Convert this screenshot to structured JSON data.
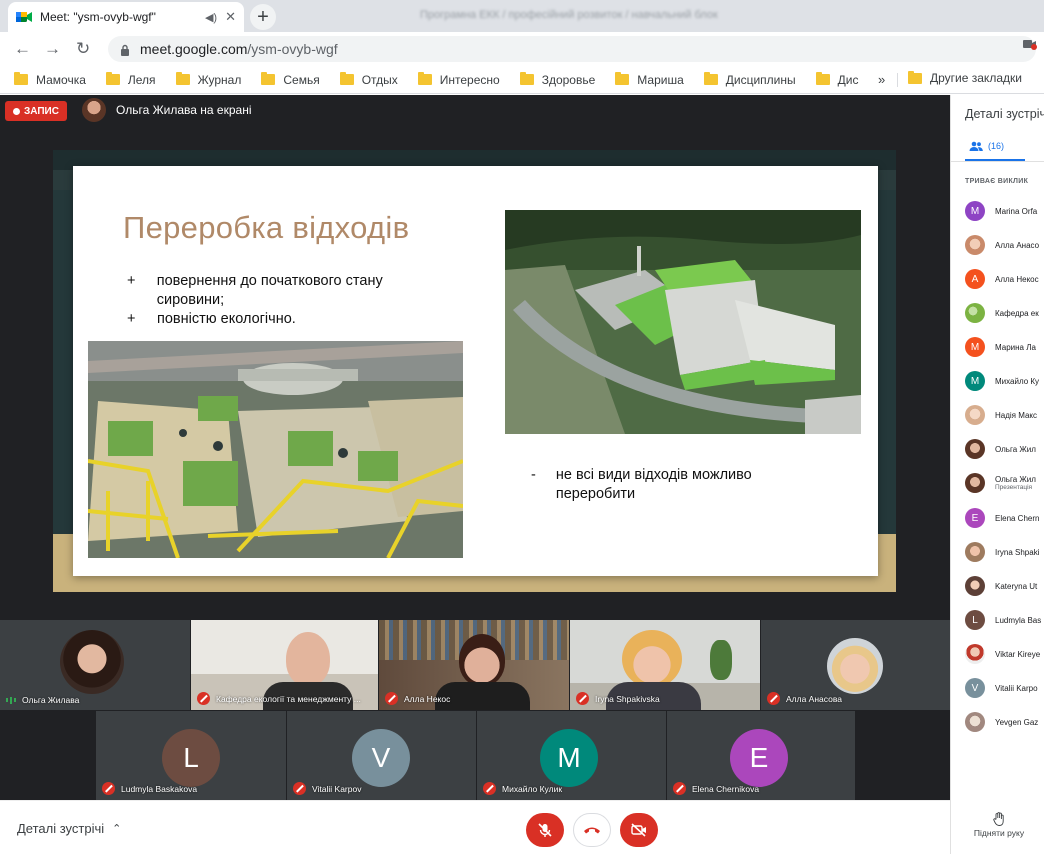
{
  "browser": {
    "tab_title": "Meet: \"ysm-ovyb-wgf\"",
    "ghost_tab_title": "Програмна ЕКК / професійний розвиток / навчальний блок",
    "url_host": "meet.google.com",
    "url_path": "/ysm-ovyb-wgf",
    "bookmarks": [
      "Мамочка",
      "Леля",
      "Журнал",
      "Семья",
      "Отдых",
      "Интересно",
      "Здоровье",
      "Мариша",
      "Дисциплины",
      "Дис"
    ],
    "bookmarks_more": "»",
    "other_bookmarks": "Другие закладки"
  },
  "meet": {
    "recording_label": "ЗАПИС",
    "presenter_text": "Ольга Жилава на екрані",
    "slide": {
      "title": "Переробка відходів",
      "bullet_marker_plus": "+",
      "bullet_marker_minus": "-",
      "pros": [
        "повернення до початкового стану сировини;",
        "повністю екологічно."
      ],
      "cons": [
        "не всі види відходів можливо переробити"
      ]
    },
    "tiles_row1": [
      {
        "name": "Ольга Жилава",
        "muted": false
      },
      {
        "name": "Кафедра екології та менеджменту ...",
        "muted": true
      },
      {
        "name": "Алла Некос",
        "muted": true
      },
      {
        "name": "Iryna Shpakivska",
        "muted": true
      },
      {
        "name": "Алла Анасова",
        "muted": true
      }
    ],
    "tiles_row2": [
      {
        "letter": "L",
        "name": "Ludmyla Baskakova",
        "color": "#6d4c41"
      },
      {
        "letter": "V",
        "name": "Vitalii Karpov",
        "color": "#78909c"
      },
      {
        "letter": "M",
        "name": "Михайло Кулик",
        "color": "#00897b"
      },
      {
        "letter": "E",
        "name": "Elena Chernikova",
        "color": "#ab47bc"
      }
    ],
    "meeting_details_label": "Деталі зустрічі"
  },
  "panel": {
    "title": "Деталі зустрічі",
    "people_count": "(16)",
    "section_label": "ТРИВАЄ ВИКЛИК",
    "people": [
      {
        "name": "Marina Orfa",
        "letter": "M",
        "color": "#8e44c4"
      },
      {
        "name": "Алла Анасо",
        "letter": "",
        "color": "#c98a6a"
      },
      {
        "name": "Алла Некос",
        "letter": "А",
        "color": "#f4511e"
      },
      {
        "name": "Кафедра ек",
        "letter": "",
        "color": "#7cb342"
      },
      {
        "name": "Марина Ла",
        "letter": "М",
        "color": "#f4511e"
      },
      {
        "name": "Михайло Ку",
        "letter": "М",
        "color": "#00897b"
      },
      {
        "name": "Надія Макс",
        "letter": "",
        "color": "#d7ad8e"
      },
      {
        "name": "Ольга Жил",
        "letter": "",
        "color": "#8d5a44"
      },
      {
        "name": "Ольга Жил",
        "letter": "",
        "color": "#8d5a44",
        "sub": "Презентація"
      },
      {
        "name": "Elena Chern",
        "letter": "E",
        "color": "#ab47bc"
      },
      {
        "name": "Iryna Shpaki",
        "letter": "",
        "color": "#9e7b5f"
      },
      {
        "name": "Kateryna Ut",
        "letter": "",
        "color": "#5d4037"
      },
      {
        "name": "Ludmyla Bas",
        "letter": "L",
        "color": "#6d4c41"
      },
      {
        "name": "Viktar Kireye",
        "letter": "",
        "color": "#c0392b"
      },
      {
        "name": "Vitalii Karpo",
        "letter": "V",
        "color": "#78909c"
      },
      {
        "name": "Yevgen Gaz",
        "letter": "",
        "color": "#a1887f"
      }
    ],
    "raise_hand_label": "Підняти руку"
  }
}
